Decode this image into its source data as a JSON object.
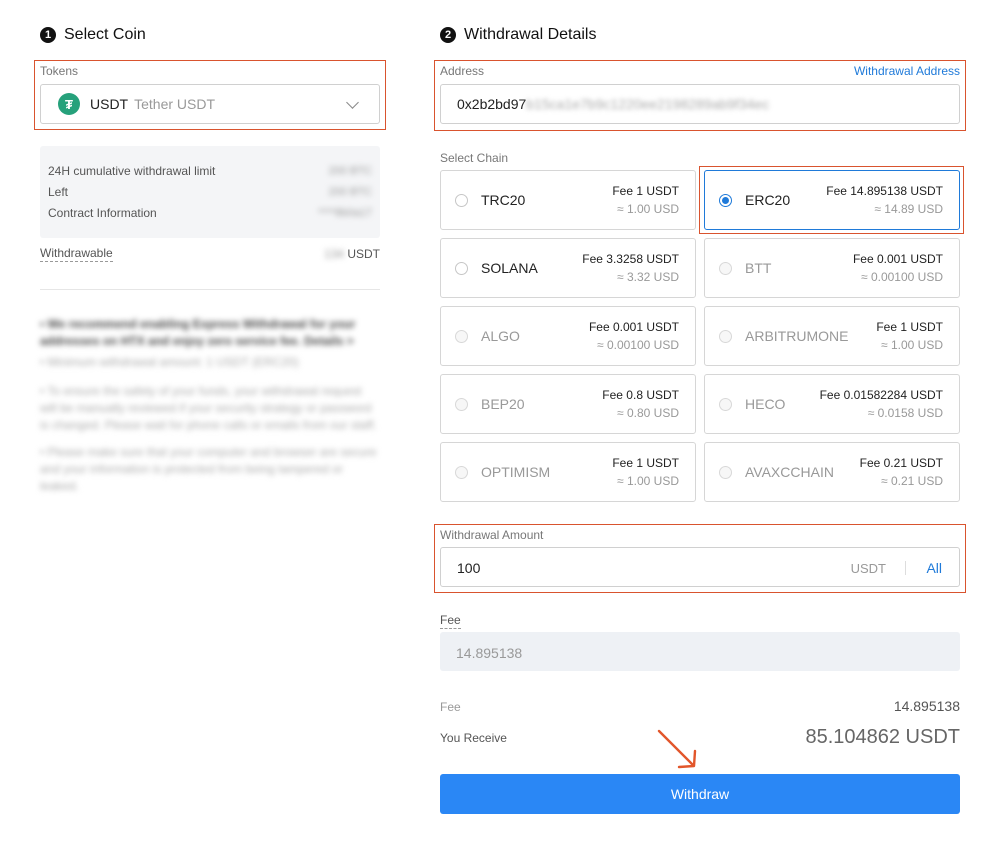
{
  "steps": {
    "select_coin": {
      "number": "1",
      "title": "Select Coin"
    },
    "withdrawal_details": {
      "number": "2",
      "title": "Withdrawal Details"
    }
  },
  "tokens": {
    "label": "Tokens",
    "selected_symbol": "USDT",
    "selected_name": "Tether USDT",
    "icon_glyph": "₮",
    "icon_color": "#26a17b"
  },
  "limits": {
    "rows": [
      {
        "label": "24H cumulative withdrawal limit",
        "value": "200 BTC"
      },
      {
        "label": "Left",
        "value": "200 BTC"
      },
      {
        "label": "Contract Information",
        "value": "****8b0a17"
      }
    ],
    "withdrawable_label": "Withdrawable",
    "withdrawable_value": "134",
    "withdrawable_unit": "USDT"
  },
  "notes": [
    "• We recommend enabling Express Withdrawal for your addresses on HTX and enjoy zero service fee. Details >",
    "• Minimum withdrawal amount: 1 USDT (ERC20)",
    "• To ensure the safety of your funds, your withdrawal request will be manually reviewed if your security strategy or password is changed. Please wait for phone calls or emails from our staff.",
    "• Please make sure that your computer and browser are secure and your information is protected from being tampered or leaked."
  ],
  "address": {
    "label": "Address",
    "link": "Withdrawal Address",
    "value_visible": "0x2b2bd97",
    "value_hidden": "b15ca1e7b9c1220ee2198289ab9f34ec"
  },
  "chain": {
    "label": "Select Chain",
    "options": [
      {
        "name": "TRC20",
        "fee": "Fee 1 USDT",
        "usd": "≈ 1.00 USD"
      },
      {
        "name": "ERC20",
        "fee": "Fee 14.895138 USDT",
        "usd": "≈ 14.89 USD"
      },
      {
        "name": "SOLANA",
        "fee": "Fee 3.3258 USDT",
        "usd": "≈ 3.32 USD"
      },
      {
        "name": "BTT",
        "fee": "Fee 0.001 USDT",
        "usd": "≈ 0.00100 USD"
      },
      {
        "name": "ALGO",
        "fee": "Fee 0.001 USDT",
        "usd": "≈ 0.00100 USD"
      },
      {
        "name": "ARBITRUMONE",
        "fee": "Fee 1 USDT",
        "usd": "≈ 1.00 USD"
      },
      {
        "name": "BEP20",
        "fee": "Fee 0.8 USDT",
        "usd": "≈ 0.80 USD"
      },
      {
        "name": "HECO",
        "fee": "Fee 0.01582284 USDT",
        "usd": "≈ 0.0158 USD"
      },
      {
        "name": "OPTIMISM",
        "fee": "Fee 1 USDT",
        "usd": "≈ 1.00 USD"
      },
      {
        "name": "AVAXCCHAIN",
        "fee": "Fee 0.21 USDT",
        "usd": "≈ 0.21 USD"
      }
    ]
  },
  "amount": {
    "label": "Withdrawal Amount",
    "value": "100",
    "unit": "USDT",
    "all_label": "All"
  },
  "fee": {
    "label": "Fee",
    "value": "14.895138"
  },
  "summary": {
    "fee_label": "Fee",
    "fee_value": "14.895138",
    "receive_label": "You Receive",
    "receive_value": "85.104862 USDT"
  },
  "withdraw_button": "Withdraw",
  "colors": {
    "accent": "#2a87f5",
    "highlight_box": "#d9532e",
    "selected_border": "#1f7ad9"
  }
}
